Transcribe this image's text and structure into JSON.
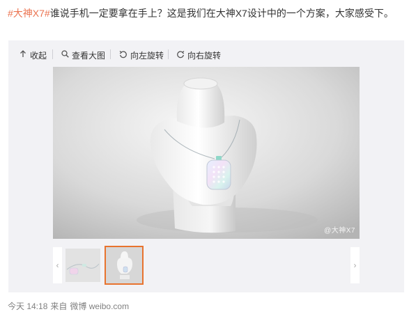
{
  "post": {
    "hashtag": "#大神X7#",
    "text": "谁说手机一定要拿在手上？这是我们在大神X7设计中的一个方案，大家感受下。"
  },
  "toolbar": {
    "collapse_label": "收起",
    "view_large_label": "查看大图",
    "rotate_left_label": "向左旋转",
    "rotate_right_label": "向右旋转"
  },
  "icons": {
    "collapse": "arrow-up-icon",
    "view_large": "magnifier-icon",
    "rotate_left": "rotate-left-icon",
    "rotate_right": "rotate-right-icon"
  },
  "image": {
    "watermark": "@大神X7"
  },
  "footer": {
    "time": "今天 14:18",
    "source_prefix": "来自",
    "source": "微博 weibo.com"
  },
  "colors": {
    "hashtag": "#eb7350",
    "selected_thumb_border": "#e8732e",
    "panel_bg": "#f2f2f5",
    "footer_text": "#808080"
  }
}
